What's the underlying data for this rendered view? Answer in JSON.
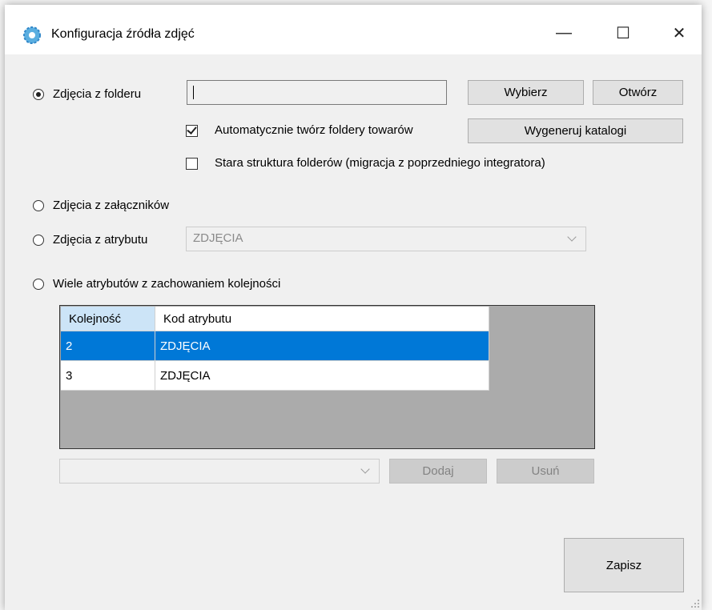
{
  "window": {
    "title": "Konfiguracja źródła zdjęć",
    "minimize_glyph": "—",
    "maximize_glyph": "☐",
    "close_glyph": "✕"
  },
  "source_options": {
    "folder": {
      "label": "Zdjęcia z folderu",
      "checked": true
    },
    "attachments": {
      "label": "Zdjęcia z załączników",
      "checked": false
    },
    "attribute": {
      "label": "Zdjęcia z atrybutu",
      "checked": false
    },
    "multi_attribute": {
      "label": "Wiele atrybutów z zachowaniem kolejności",
      "checked": false
    }
  },
  "folder": {
    "path_value": "",
    "choose_button": "Wybierz",
    "open_button": "Otwórz",
    "auto_create_label": "Automatycznie twórz foldery towarów",
    "auto_create_checked": true,
    "generate_button": "Wygeneruj katalogi",
    "old_structure_label": "Stara struktura folderów (migracja z poprzedniego integratora)",
    "old_structure_checked": false
  },
  "attribute": {
    "selected_value": "ZDJĘCIA"
  },
  "attributes_grid": {
    "columns": [
      "Kolejność",
      "Kod atrybutu"
    ],
    "rows": [
      {
        "order": "2",
        "code": "ZDJĘCIA",
        "selected": true
      },
      {
        "order": "3",
        "code": "ZDJĘCIA",
        "selected": false
      }
    ]
  },
  "grid_controls": {
    "combo_value": "",
    "add_button": "Dodaj",
    "remove_button": "Usuń"
  },
  "save_button": "Zapisz",
  "colors": {
    "selection": "#0078d7",
    "header_sorted": "#cce4f7",
    "grid_background": "#ababab"
  }
}
